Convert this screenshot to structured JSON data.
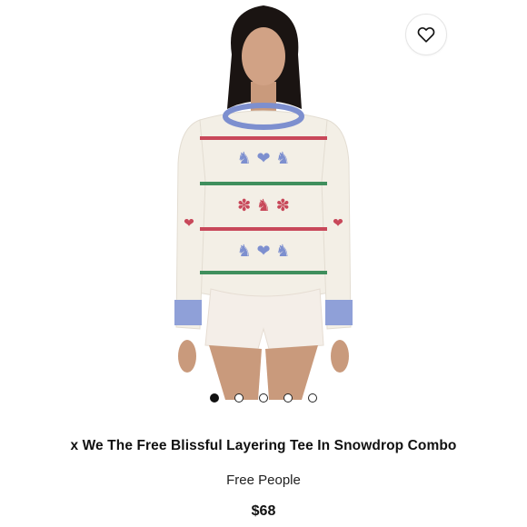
{
  "product": {
    "title": "x We The Free Blissful Layering Tee In Snowdrop Combo",
    "brand": "Free People",
    "price": "$68"
  },
  "gallery": {
    "image_count": 5,
    "active_index": 0
  },
  "icons": {
    "wishlist": "heart-outline-icon"
  },
  "colors": {
    "accent": "#111111",
    "sweater": "#f3efe6",
    "pattern_blue": "#7d8fcf",
    "pattern_red": "#c8485a",
    "pattern_green": "#3f8f5d"
  }
}
